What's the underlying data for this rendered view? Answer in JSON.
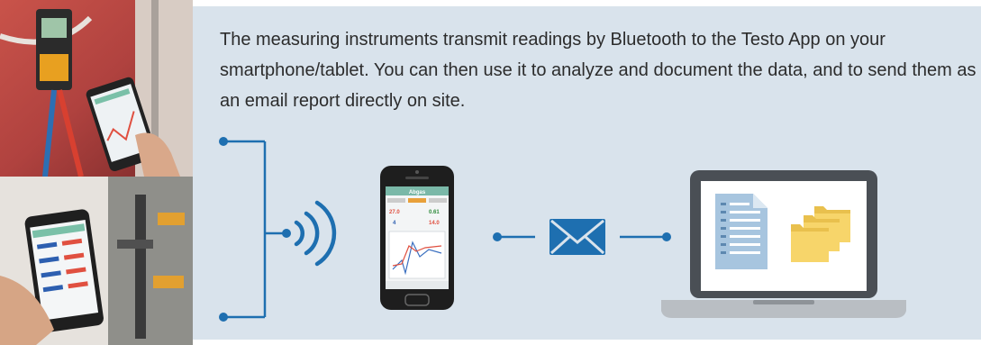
{
  "description": "The measuring instruments transmit readings by Bluetooth to the Testo App on your smartphone/tablet. You can then use it to analyze and document the data, and to send them as an email report directly on site.",
  "phone_screen": {
    "title": "Abgas",
    "values": [
      "27.0",
      "0.61",
      "14.0",
      "4"
    ]
  },
  "colors": {
    "panel_bg": "#d9e3ec",
    "accent_blue": "#1e6fb0",
    "text": "#2c2c2c",
    "folder": "#f7d56a",
    "document": "#a7c5df"
  },
  "icons": [
    "bluetooth-signal-icon",
    "smartphone-icon",
    "email-envelope-icon",
    "laptop-icon",
    "document-icon",
    "folder-stack-icon"
  ]
}
